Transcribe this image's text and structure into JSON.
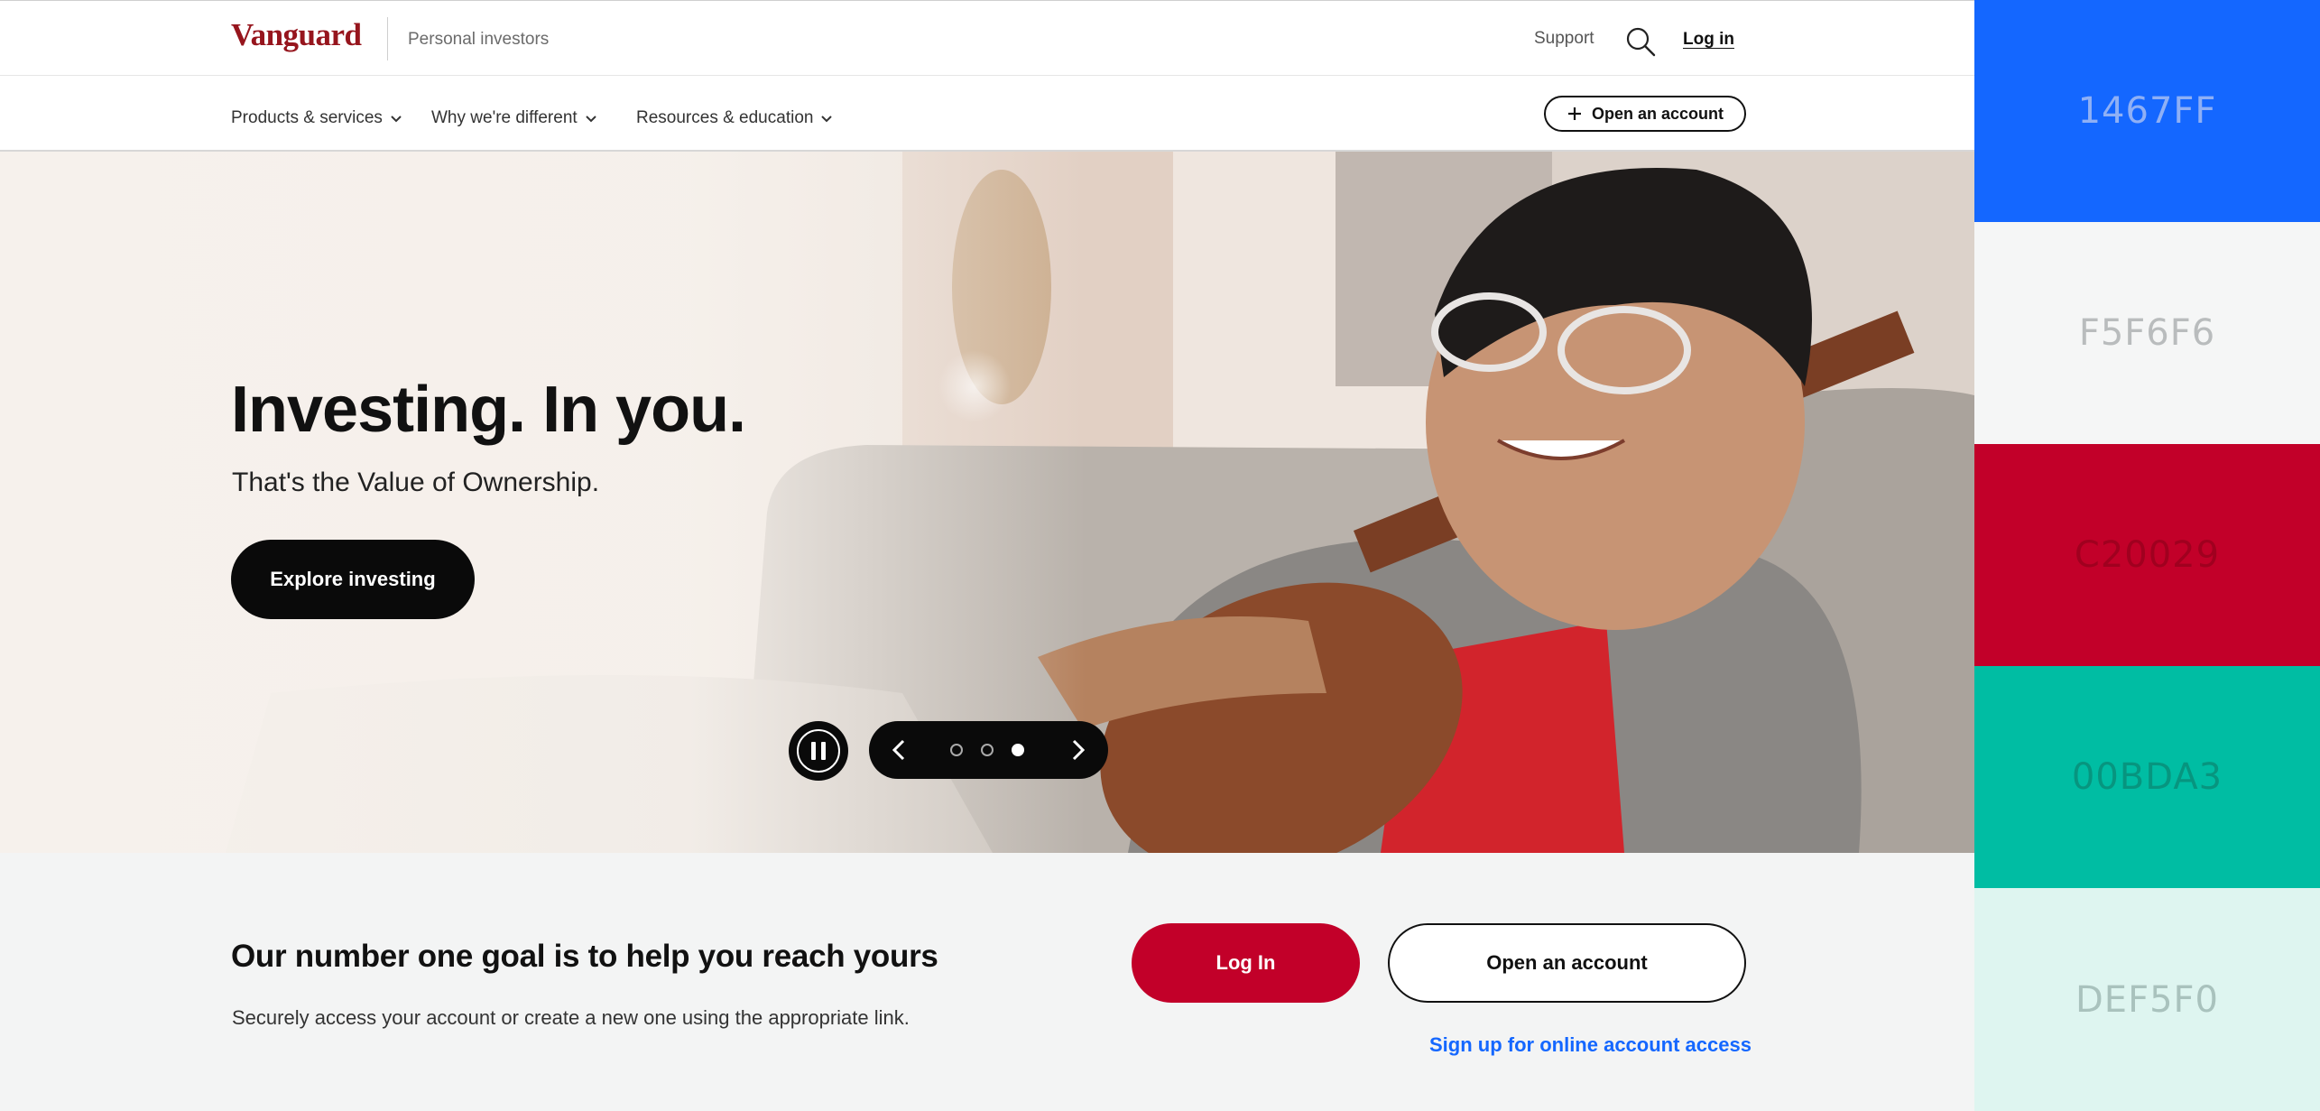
{
  "header": {
    "logo_text": "Vanguard",
    "section_label": "Personal investors",
    "support_label": "Support",
    "search_icon": "search-icon",
    "login_label": "Log in"
  },
  "nav": {
    "items": [
      {
        "label": "Products & services"
      },
      {
        "label": "Why we're different"
      },
      {
        "label": "Resources & education"
      }
    ],
    "open_account_label": "Open an account"
  },
  "hero": {
    "title": "Investing. In you.",
    "subtitle": "That's the Value of Ownership.",
    "cta_label": "Explore investing",
    "carousel": {
      "total_slides": 3,
      "active_slide": 3
    }
  },
  "goal_section": {
    "title": "Our number one goal is to help you reach yours",
    "description": "Securely access your account or create a new one using the appropriate link.",
    "login_label": "Log In",
    "open_account_label": "Open an account",
    "signup_link": "Sign up for online account access"
  },
  "palette": {
    "swatches": [
      {
        "hex": "1467FF",
        "color": "#1467FF",
        "text_color": "#8fb0f5"
      },
      {
        "hex": "F5F6F6",
        "color": "#F5F6F6",
        "text_color": "#b9bcbd"
      },
      {
        "hex": "C20029",
        "color": "#C20029",
        "text_color": "#a0001f"
      },
      {
        "hex": "00BDA3",
        "color": "#00BDA3",
        "text_color": "#07957f"
      },
      {
        "hex": "DEF5F0",
        "color": "#DEF5F0",
        "text_color": "#a9c2bd"
      }
    ]
  },
  "colors": {
    "brand_red": "#96151d",
    "login_red": "#c20029",
    "link_blue": "#1467ff",
    "band_gray": "#f3f4f4"
  }
}
